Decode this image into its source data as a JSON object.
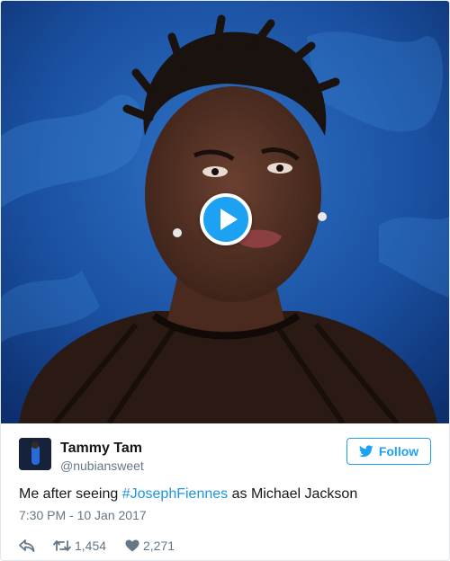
{
  "media": {
    "type": "animated-gif",
    "play_icon": "play-icon"
  },
  "author": {
    "display_name": "Tammy Tam",
    "screen_name": "@nubiansweet"
  },
  "follow_button": {
    "label": "Follow",
    "icon": "twitter-bird-icon"
  },
  "tweet": {
    "text_before": "Me after seeing ",
    "hashtag": "#JosephFiennes",
    "text_after": " as Michael Jackson",
    "timestamp": "7:30 PM - 10 Jan 2017"
  },
  "actions": {
    "reply_icon": "reply-icon",
    "retweet_icon": "retweet-icon",
    "retweet_count": "1,454",
    "like_icon": "heart-icon",
    "like_count": "2,271"
  },
  "colors": {
    "accent": "#1da1f2",
    "link": "#1b95e0",
    "text": "#14171a",
    "muted": "#657786"
  }
}
